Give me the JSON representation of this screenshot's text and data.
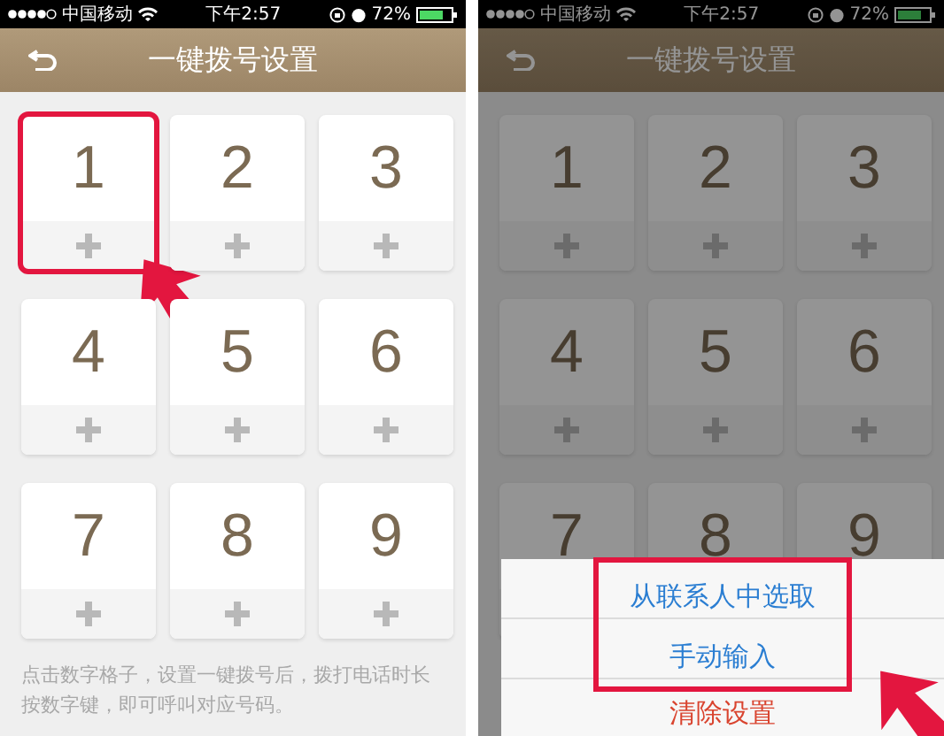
{
  "screens": [
    {
      "status_bar": {
        "carrier": "中国移动",
        "time": "下午2:57",
        "battery": "72%"
      },
      "title": "一键拨号设置",
      "dimmed": false,
      "tiles": [
        {
          "digit": "1",
          "highlighted": true
        },
        {
          "digit": "2",
          "highlighted": false
        },
        {
          "digit": "3",
          "highlighted": false
        },
        {
          "digit": "4",
          "highlighted": false
        },
        {
          "digit": "5",
          "highlighted": false
        },
        {
          "digit": "6",
          "highlighted": false
        },
        {
          "digit": "7",
          "highlighted": false
        },
        {
          "digit": "8",
          "highlighted": false
        },
        {
          "digit": "9",
          "highlighted": false
        }
      ],
      "hint": "点击数字格子，设置一键拨号后，拨打电话时长按数字键，即可呼叫对应号码。"
    },
    {
      "status_bar": {
        "carrier": "中国移动",
        "time": "下午2:57",
        "battery": "72%"
      },
      "title": "一键拨号设置",
      "dimmed": true,
      "tiles": [
        {
          "digit": "1",
          "highlighted": false
        },
        {
          "digit": "2",
          "highlighted": false
        },
        {
          "digit": "3",
          "highlighted": false
        },
        {
          "digit": "4",
          "highlighted": false
        },
        {
          "digit": "5",
          "highlighted": false
        },
        {
          "digit": "6",
          "highlighted": false
        },
        {
          "digit": "7",
          "highlighted": false
        },
        {
          "digit": "8",
          "highlighted": false
        },
        {
          "digit": "9",
          "highlighted": false
        }
      ],
      "action_sheet": {
        "items": [
          {
            "label": "从联系人中选取",
            "kind": "normal",
            "highlighted": true
          },
          {
            "label": "手动输入",
            "kind": "normal",
            "highlighted": true
          },
          {
            "label": "清除设置",
            "kind": "destructive",
            "highlighted": false
          }
        ]
      }
    }
  ]
}
